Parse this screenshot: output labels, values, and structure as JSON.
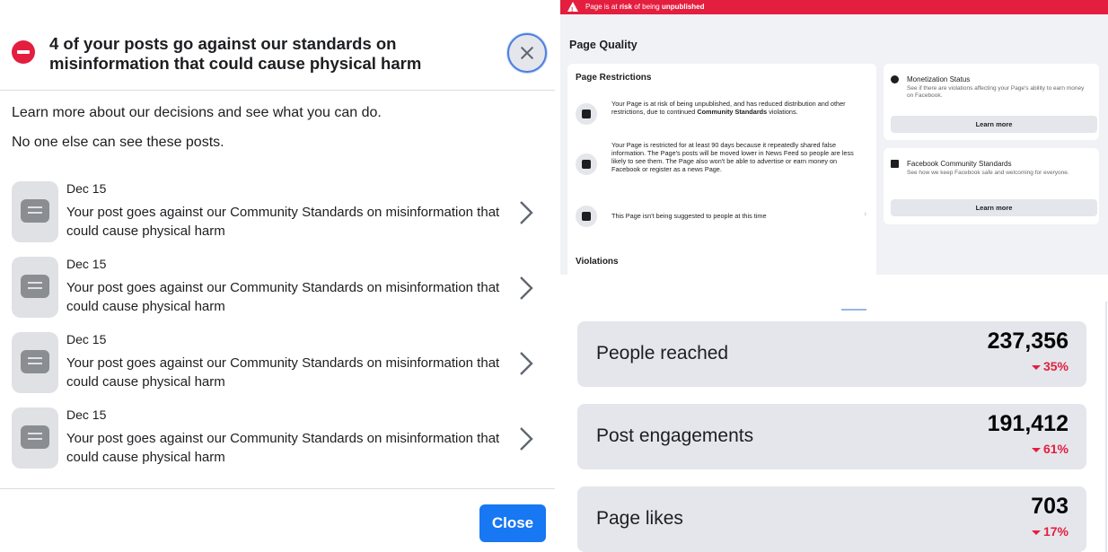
{
  "dialog": {
    "title": "4 of your posts go against our standards on misinformation that could cause physical harm",
    "intro_line1": "Learn more about our decisions and see what you can do.",
    "intro_line2": "No one else can see these posts.",
    "posts": [
      {
        "date": "Dec 15",
        "text": "Your post goes against our Community Standards on misinformation that could cause physical harm"
      },
      {
        "date": "Dec 15",
        "text": "Your post goes against our Community Standards on misinformation that could cause physical harm"
      },
      {
        "date": "Dec 15",
        "text": "Your post goes against our Community Standards on misinformation that could cause physical harm"
      },
      {
        "date": "Dec 15",
        "text": "Your post goes against our Community Standards on misinformation that could cause physical harm"
      }
    ],
    "close_label": "Close",
    "icons": {
      "warning": "no-entry-icon",
      "close": "close-icon",
      "post": "document-icon",
      "chevron": "chevron-right-icon"
    }
  },
  "page_quality": {
    "banner_prefix": "Page is at ",
    "banner_risk": "risk",
    "banner_middle": " of being ",
    "banner_unpublished": "unpublished",
    "title": "Page Quality",
    "restrictions_title": "Page Restrictions",
    "restrictions": [
      {
        "text": "Your Page is at risk of being unpublished, and has reduced distribution and other restrictions, due to continued ",
        "bold": "Community Standards",
        "tail": " violations.",
        "icon": "shield-icon"
      },
      {
        "text": "Your Page is restricted for at least 90 days because it repeatedly shared false information. The Page's posts will be moved lower in News Feed so people are less likely to see them. The Page also won't be able to advertise or earn money on Facebook or register as a news Page.",
        "bold": "",
        "tail": "",
        "icon": "news-feed-icon"
      },
      {
        "text": "This Page isn't being suggested to people at this time",
        "bold": "",
        "tail": "",
        "icon": "hidden-icon"
      }
    ],
    "violations_title": "Violations",
    "monetization": {
      "title": "Monetization Status",
      "desc": "See if there are violations affecting your Page's ability to earn money on Facebook.",
      "button": "Learn more",
      "icon": "dollar-icon"
    },
    "community": {
      "title": "Facebook Community Standards",
      "desc": "See how we keep Facebook safe and welcoming for everyone.",
      "button": "Learn more",
      "icon": "book-icon"
    },
    "colors": {
      "banner": "#e41e3f"
    }
  },
  "metrics": [
    {
      "label": "People reached",
      "value": "237,356",
      "delta": "35%"
    },
    {
      "label": "Post engagements",
      "value": "191,412",
      "delta": "61%"
    },
    {
      "label": "Page likes",
      "value": "703",
      "delta": "17%"
    }
  ],
  "colors": {
    "accent": "#1877f2",
    "negative": "#e41e3f"
  }
}
